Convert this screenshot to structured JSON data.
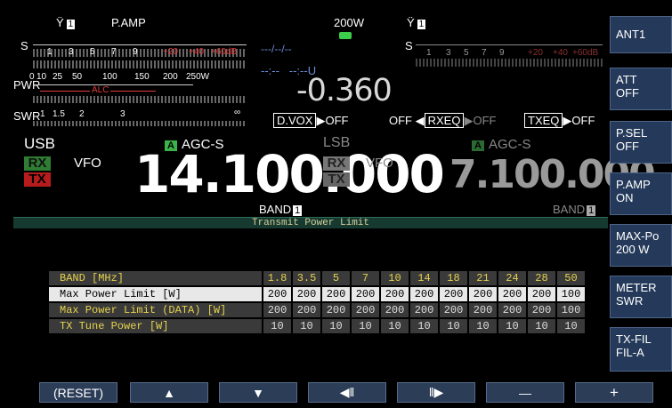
{
  "top": {
    "sub_icon_left": "antenna-1-icon",
    "ant_left": "1",
    "pamp": "P.AMP",
    "power": "200W",
    "ant_right": "1"
  },
  "meters": {
    "s_label": "S",
    "s_scale": [
      "1",
      "3",
      "5",
      "7",
      "9",
      "+20",
      "+40",
      "+60dB"
    ],
    "pwr_label": "PWR",
    "pwr_scale": [
      "0",
      "10",
      "25",
      "50",
      "100",
      "150",
      "200",
      "250W"
    ],
    "alc_label": "ALC",
    "swr_label": "SWR",
    "swr_scale": [
      "1",
      "1.5",
      "2",
      "3",
      "∞"
    ],
    "s_right_label": "S",
    "s_right_scale": [
      "1",
      "3",
      "5",
      "7",
      "9",
      "+20",
      "+40",
      "+60dB"
    ]
  },
  "center": {
    "clock": "---/--/--",
    "time": "--:--   --:--U",
    "rit": "-0.360",
    "dvox": "D.VOX",
    "dvox_state": "▶OFF",
    "rxeq_prefix": "OFF ◀",
    "rxeq": "RXEQ",
    "rxeq_state": "▶OFF",
    "txeq": "TXEQ",
    "txeq_state": "▶OFF"
  },
  "main_vfo": {
    "mode": "USB",
    "agc_badge": "A",
    "agc": "AGC-S",
    "rx": "RX",
    "tx": "TX",
    "vfo": "VFO",
    "freq": "14.100.000",
    "band_label": "BAND",
    "band_num": "1"
  },
  "sub_vfo": {
    "mode": "LSB",
    "agc_badge": "A",
    "agc": "AGC-S",
    "rx": "RX",
    "tx": "TX",
    "vfo": "VFO",
    "freq": "7.100.000",
    "band_label": "BAND",
    "band_num": "1"
  },
  "dialog": {
    "title": "Transmit Power Limit",
    "header": {
      "label": "BAND [MHz]",
      "values": [
        "1.8",
        "3.5",
        "5",
        "7",
        "10",
        "14",
        "18",
        "21",
        "24",
        "28",
        "50"
      ]
    },
    "rows": [
      {
        "label": "Max Power Limit [W]",
        "values": [
          "200",
          "200",
          "200",
          "200",
          "200",
          "200",
          "200",
          "200",
          "200",
          "200",
          "100"
        ]
      },
      {
        "label": "Max Power Limit (DATA) [W]",
        "values": [
          "200",
          "200",
          "200",
          "200",
          "200",
          "200",
          "200",
          "200",
          "200",
          "200",
          "100"
        ]
      },
      {
        "label": "TX Tune Power [W]",
        "values": [
          "10",
          "10",
          "10",
          "10",
          "10",
          "10",
          "10",
          "10",
          "10",
          "10",
          "10"
        ]
      }
    ]
  },
  "side": {
    "buttons": [
      "ANT1",
      "ATT\nOFF",
      "P.SEL\nOFF",
      "P.AMP\nON",
      "MAX-Po\n200 W",
      "METER\nSWR",
      "TX-FIL\nFIL-A"
    ]
  },
  "bottom": {
    "reset": "(RESET)",
    "up": "▲",
    "down": "▼",
    "left": "◀‖",
    "right": "‖▶",
    "minus": "—",
    "plus": "+"
  },
  "colors": {
    "accent_green": "#3cb24a",
    "alc_red": "#e43b3b",
    "highlight_yellow": "#f1d66e",
    "button_blue": "#253a5a"
  }
}
